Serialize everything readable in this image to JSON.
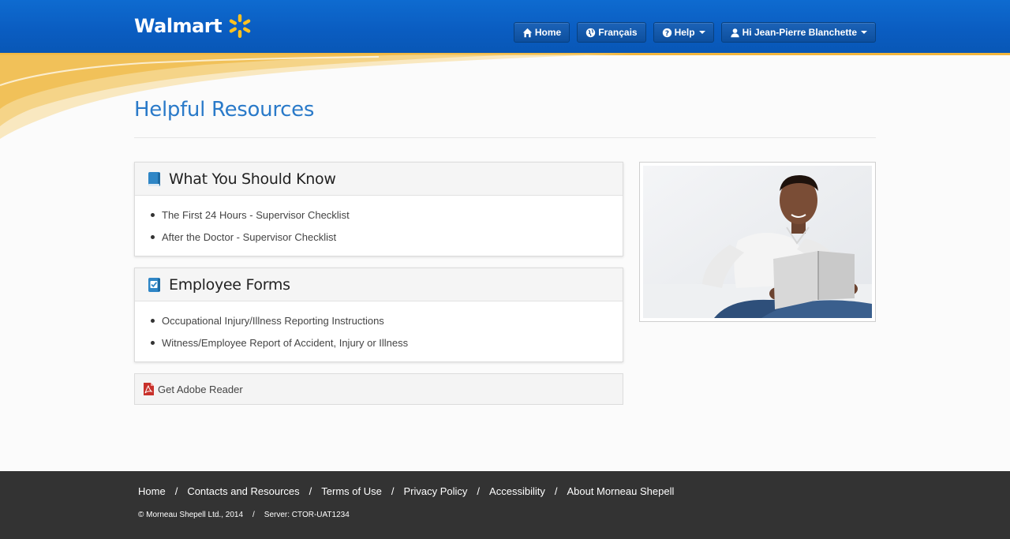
{
  "header": {
    "logo_text": "Walmart",
    "brand_color": "#0b63c4",
    "accent_color": "#f2b63c",
    "nav": {
      "home": "Home",
      "language": "Français",
      "help": "Help",
      "user": "Hi Jean-Pierre Blanchette"
    }
  },
  "main": {
    "page_title": "Helpful Resources",
    "panels": [
      {
        "title": "What You Should Know",
        "icon": "book-icon",
        "items": [
          "The First 24 Hours - Supervisor Checklist",
          "After the Doctor - Supervisor Checklist"
        ]
      },
      {
        "title": "Employee Forms",
        "icon": "checked-form-icon",
        "items": [
          "Occupational Injury/Illness Reporting Instructions",
          "Witness/Employee Report of Accident, Injury or Illness"
        ]
      }
    ],
    "adobe_link": "Get Adobe Reader"
  },
  "footer": {
    "links": [
      "Home",
      "Contacts and Resources",
      "Terms of Use",
      "Privacy Policy",
      "Accessibility",
      "About Morneau Shepell"
    ],
    "copyright": "© Morneau Shepell Ltd., 2014",
    "server": "Server: CTOR-UAT1234"
  }
}
